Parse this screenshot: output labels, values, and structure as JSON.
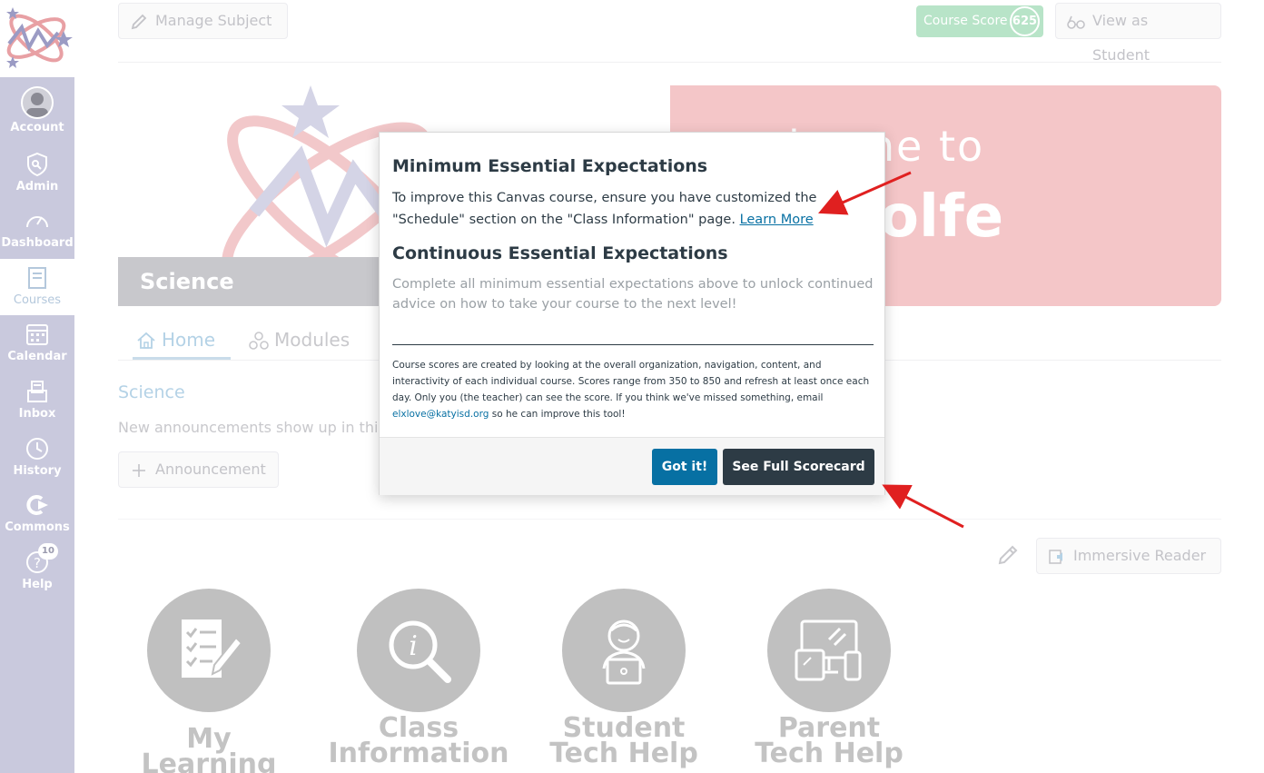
{
  "nav": {
    "items": [
      {
        "label": "Account",
        "icon": "avatar"
      },
      {
        "label": "Admin",
        "icon": "shield-icon"
      },
      {
        "label": "Dashboard",
        "icon": "dashboard-icon"
      },
      {
        "label": "Courses",
        "icon": "book-icon",
        "active": true
      },
      {
        "label": "Calendar",
        "icon": "calendar-icon"
      },
      {
        "label": "Inbox",
        "icon": "inbox-icon"
      },
      {
        "label": "History",
        "icon": "clock-icon"
      },
      {
        "label": "Commons",
        "icon": "commons-icon"
      },
      {
        "label": "Help",
        "icon": "help-icon",
        "badge": "10"
      }
    ]
  },
  "topbar": {
    "manage_subject": "Manage Subject",
    "course_score_label": "Course Score",
    "course_score_value": "625",
    "view_as_student": "View as Student"
  },
  "banner": {
    "science_title": "Science",
    "welcome": "lcome to",
    "name": "olfe"
  },
  "tabs": {
    "home": "Home",
    "modules": "Modules"
  },
  "content": {
    "science_link": "Science",
    "announce_text": "New announcements show up in thi",
    "announcement_button": "Announcement",
    "immersive_reader": "Immersive Reader"
  },
  "tiles": [
    {
      "label": "My Learning",
      "icon": "checklist-pencil-icon"
    },
    {
      "label": "Class\nInformation",
      "icon": "info-magnifier-icon"
    },
    {
      "label": "Student\nTech Help",
      "icon": "student-laptop-icon"
    },
    {
      "label": "Parent\nTech Help",
      "icon": "devices-icon"
    }
  ],
  "modal": {
    "min_heading": "Minimum Essential Expectations",
    "min_text": "To improve this Canvas course, ensure you have customized the \"Schedule\" section on the \"Class Information\" page.",
    "learn_more": "Learn More",
    "cont_heading": "Continuous Essential Expectations",
    "cont_text": "Complete all minimum essential expectations above to unlock continued advice on how to take your course to the next level!",
    "small_text": "Course scores are created by looking at the overall organization, navigation, content, and interactivity of each individual course. Scores range from 350 to 850 and refresh at least once each day. Only you (the teacher) can see the score. If you think we've missed something, email",
    "email": "elxlove@katyisd.org",
    "small_text_end": "so he can improve this tool!",
    "got_it": "Got it!",
    "see_scorecard": "See Full Scorecard"
  },
  "colors": {
    "nav_bg": "#c9c9dd",
    "score_green": "#b8e4c8",
    "banner_pink": "#f4c6c8",
    "primary_blue": "#0770a3",
    "dark_button": "#2d3b45",
    "arrow_red": "#e02020"
  }
}
